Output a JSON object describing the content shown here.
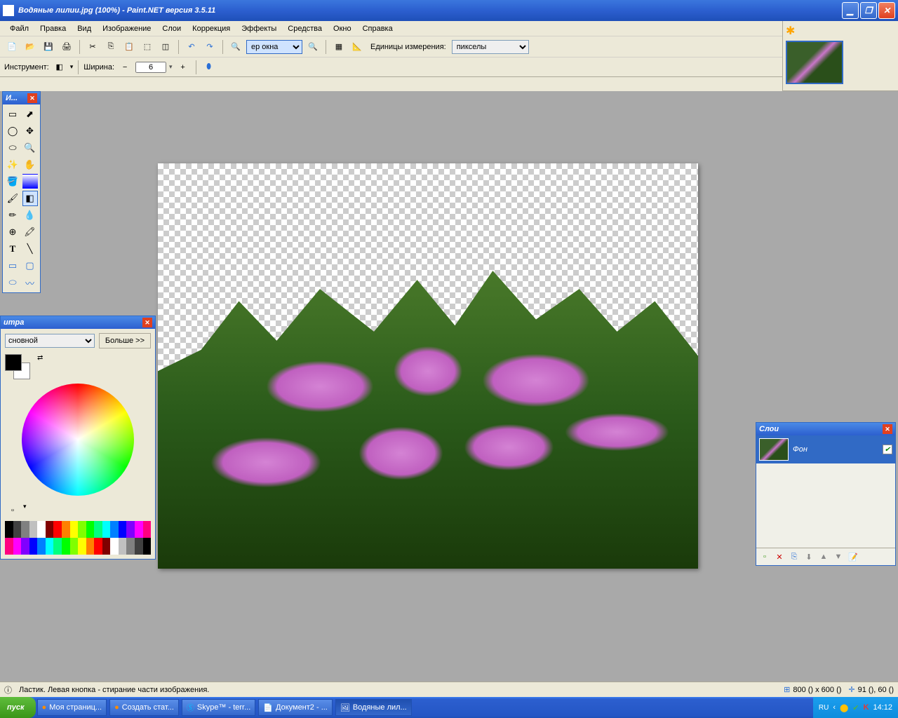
{
  "titlebar": {
    "text": "Водяные лилии.jpg (100%) - Paint.NET версия 3.5.11"
  },
  "menu": [
    "Файл",
    "Правка",
    "Вид",
    "Изображение",
    "Слои",
    "Коррекция",
    "Эффекты",
    "Средства",
    "Окно",
    "Справка"
  ],
  "toolbar1": {
    "zoom_value": "ер окна",
    "units_label": "Единицы измерения:",
    "units_value": "пикселы"
  },
  "toolbar2": {
    "tool_label": "Инструмент:",
    "width_label": "Ширина:",
    "width_value": "6"
  },
  "tools_panel": {
    "title": "И..."
  },
  "colors_panel": {
    "title": "итра",
    "mode": "сновной",
    "more": "Больше >>"
  },
  "layers_panel": {
    "title": "Слои",
    "layer_name": "Фон"
  },
  "status": {
    "hint": "Ластик. Левая кнопка - стирание части изображения.",
    "dims": "800 () x 600 ()",
    "cursor": "91 (), 60 ()"
  },
  "taskbar": {
    "start": "пуск",
    "items": [
      "Моя страниц...",
      "Создать стат...",
      "Skype™ - terr...",
      "Документ2 - ...",
      "Водяные лил..."
    ],
    "lang": "RU",
    "time": "14:12"
  },
  "palette_colors": [
    "#000",
    "#404040",
    "#808080",
    "#c0c0c0",
    "#fff",
    "#800000",
    "#f00",
    "#ff8000",
    "#ff0",
    "#80ff00",
    "#0f0",
    "#00ff80",
    "#0ff",
    "#0080ff",
    "#00f",
    "#8000ff",
    "#f0f",
    "#ff0080"
  ]
}
